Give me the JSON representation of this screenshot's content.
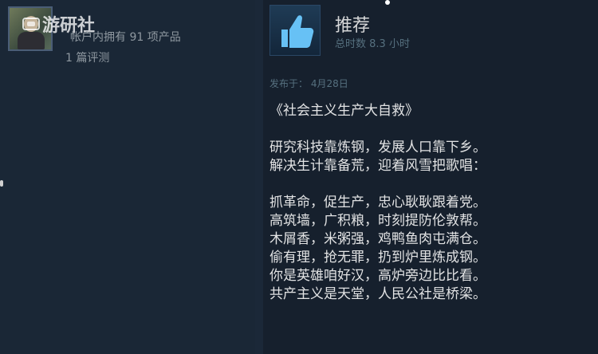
{
  "user": {
    "products_owned": "帐户内拥有 91 项产品",
    "review_count": "1 篇评测"
  },
  "watermark": {
    "text": "游研社"
  },
  "review": {
    "recommendation": "推荐",
    "hours": "总时数 8.3 小时",
    "posted": "发布于： 4月28日",
    "title": "《社会主义生产大自救》",
    "lines_a": [
      "研究科技靠炼钢，发展人口靠下乡。",
      "解决生计靠备荒，迎着风雪把歌唱："
    ],
    "lines_b": [
      "抓革命，促生产，忠心耿耿跟着党。",
      "高筑墙，广积粮，时刻提防伦敦帮。",
      "木屑香，米粥强，鸡鸭鱼肉屯满仓。",
      "偷有理，抢无罪，扔到炉里炼成钢。",
      "你是英雄咱好汉，高炉旁边比比看。",
      "共产主义是天堂，人民公社是桥梁。"
    ]
  },
  "colors": {
    "background": "#1b2838",
    "accent_blue": "#67c1f5",
    "text_muted": "#8f98a0"
  },
  "icons": {
    "recommend": "thumbs-up-icon"
  }
}
